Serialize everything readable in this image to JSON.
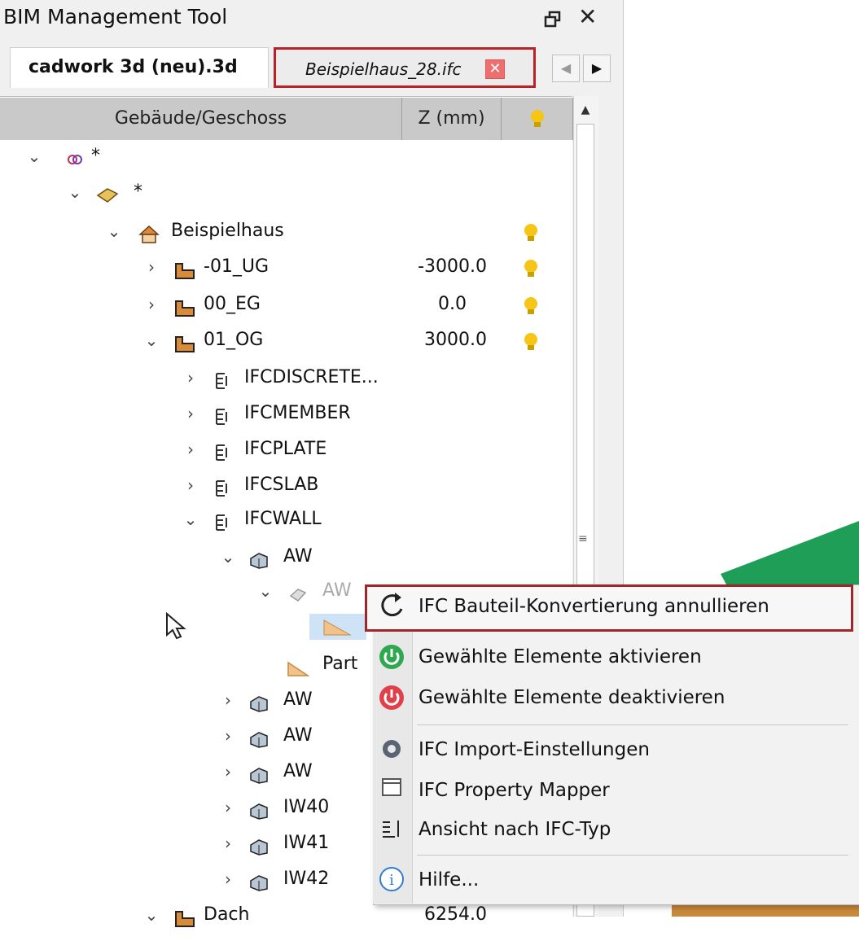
{
  "window": {
    "title": "BIM Management Tool"
  },
  "tabs": [
    {
      "label": "cadwork 3d (neu).3d",
      "active": true
    },
    {
      "label": "Beispielhaus_28.ifc",
      "active": false
    }
  ],
  "columns": {
    "name": "Gebäude/Geschoss",
    "z": "Z (mm)"
  },
  "tree": {
    "root": "*",
    "site": "*",
    "building": "Beispielhaus",
    "storeys": [
      {
        "name": "-01_UG",
        "z": "-3000.0"
      },
      {
        "name": "00_EG",
        "z": "0.0"
      },
      {
        "name": "01_OG",
        "z": "3000.0"
      }
    ],
    "ifc_types": [
      "IFCDISCRETE...",
      "IFCMEMBER",
      "IFCPLATE",
      "IFCSLAB",
      "IFCWALL"
    ],
    "wall_group": "AW",
    "wall_sub": "AW",
    "part": "Part",
    "walls": [
      "AW",
      "AW",
      "AW",
      "IW40",
      "IW41",
      "IW42"
    ],
    "last_storey": {
      "name": "Dach",
      "z": "6254.0"
    }
  },
  "context_menu": {
    "items": [
      {
        "label": "IFC Bauteil-Konvertierung annullieren",
        "icon": "refresh-icon"
      },
      {
        "label": "Gewählte Elemente aktivieren",
        "icon": "power-on-icon"
      },
      {
        "label": "Gewählte Elemente deaktivieren",
        "icon": "power-off-icon"
      },
      {
        "label": "IFC Import-Einstellungen",
        "icon": "gear-icon"
      },
      {
        "label": "IFC Property Mapper",
        "icon": "window-icon"
      },
      {
        "label": "Ansicht nach IFC-Typ",
        "icon": "list-icon"
      },
      {
        "label": "Hilfe...",
        "icon": "info-icon"
      }
    ]
  },
  "colors": {
    "highlight_border": "#a0262c",
    "bulb": "#f5c518",
    "storey_icon": "#d98b3a"
  }
}
